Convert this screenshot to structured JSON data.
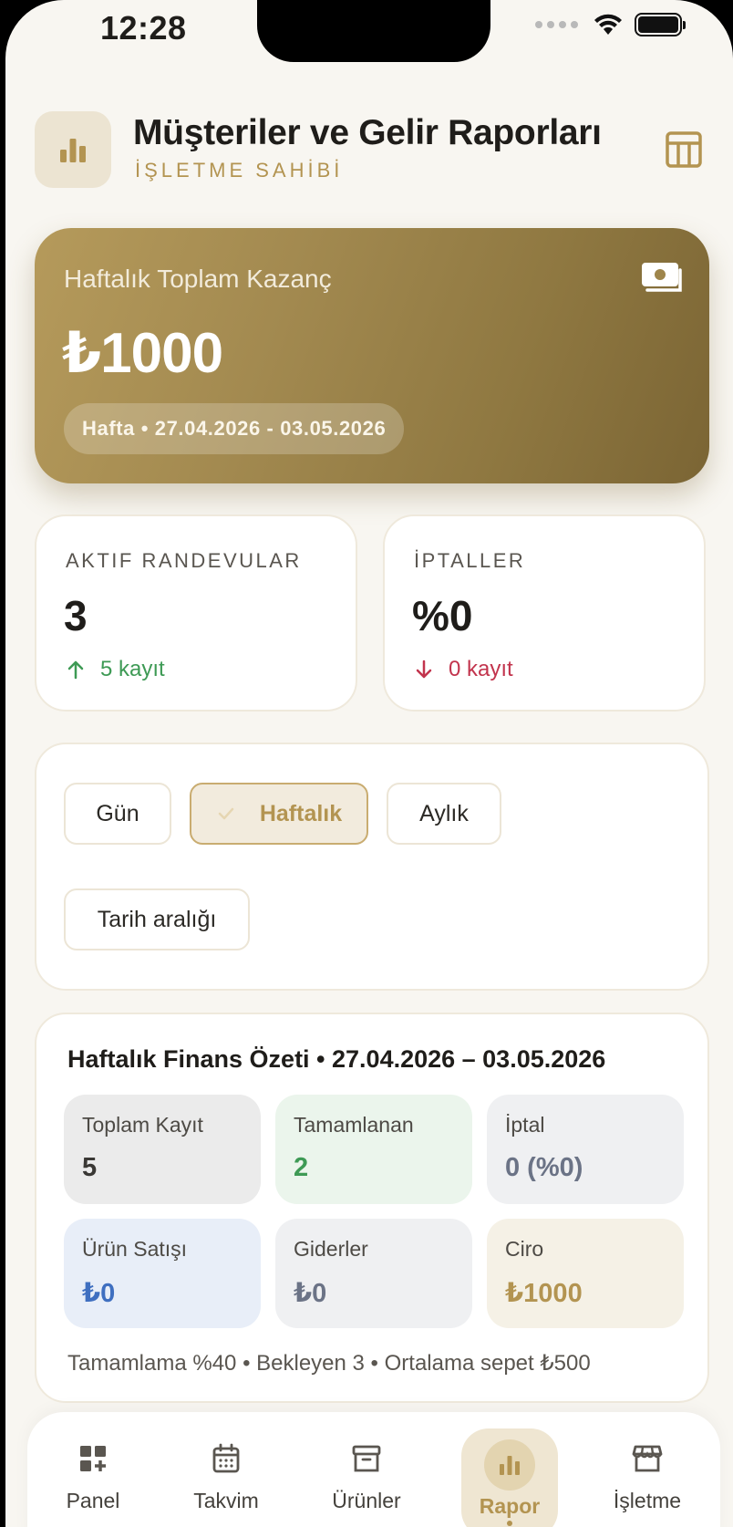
{
  "status_bar": {
    "time": "12:28"
  },
  "header": {
    "title": "Müşteriler ve Gelir Raporları",
    "subtitle": "İŞLETME SAHİBİ",
    "logo_icon": "bar-chart-icon",
    "action_icon": "table-icon"
  },
  "hero": {
    "label": "Haftalık Toplam Kazanç",
    "value": "₺1000",
    "period": "Hafta • 27.04.2026 - 03.05.2026",
    "icon": "cash-icon"
  },
  "stats": [
    {
      "label": "AKTIF RANDEVULAR",
      "value": "3",
      "trend": "5 kayıt",
      "direction": "up",
      "color": "#3e9a55"
    },
    {
      "label": "İPTALLER",
      "value": "%0",
      "trend": "0 kayıt",
      "direction": "down",
      "color": "#c2344d"
    }
  ],
  "filters": {
    "options": [
      "Gün",
      "Haftalık",
      "Aylık"
    ],
    "selected": "Haftalık",
    "date_range": "Tarih aralığı"
  },
  "finance": {
    "title": "Haftalık Finans Özeti • 27.04.2026 – 03.05.2026",
    "tiles": [
      {
        "label": "Toplam Kayıt",
        "value": "5",
        "bg": "#ebebeb",
        "color": "#3a3835"
      },
      {
        "label": "Tamamlanan",
        "value": "2",
        "bg": "#ebf5ec",
        "color": "#3e9a55"
      },
      {
        "label": "İptal",
        "value": "0 (%0)",
        "bg": "#eff0f2",
        "color": "#6b7386"
      },
      {
        "label": "Ürün Satışı",
        "value": "₺0",
        "bg": "#e8eef8",
        "color": "#3f6fc0"
      },
      {
        "label": "Giderler",
        "value": "₺0",
        "bg": "#eff0f2",
        "color": "#6b7386"
      },
      {
        "label": "Ciro",
        "value": "₺1000",
        "bg": "#f5f1e6",
        "color": "#b39451"
      }
    ],
    "footer": "Tamamlama %40 • Bekleyen 3 • Ortalama sepet ₺500"
  },
  "nav": {
    "items": [
      {
        "label": "Panel",
        "icon": "dashboard-add-icon"
      },
      {
        "label": "Takvim",
        "icon": "calendar-icon"
      },
      {
        "label": "Ürünler",
        "icon": "archive-box-icon"
      },
      {
        "label": "Rapor",
        "icon": "bar-chart-icon",
        "active": true
      },
      {
        "label": "İşletme",
        "icon": "storefront-icon"
      }
    ]
  },
  "colors": {
    "accent": "#b39451",
    "background": "#f8f6f1"
  }
}
